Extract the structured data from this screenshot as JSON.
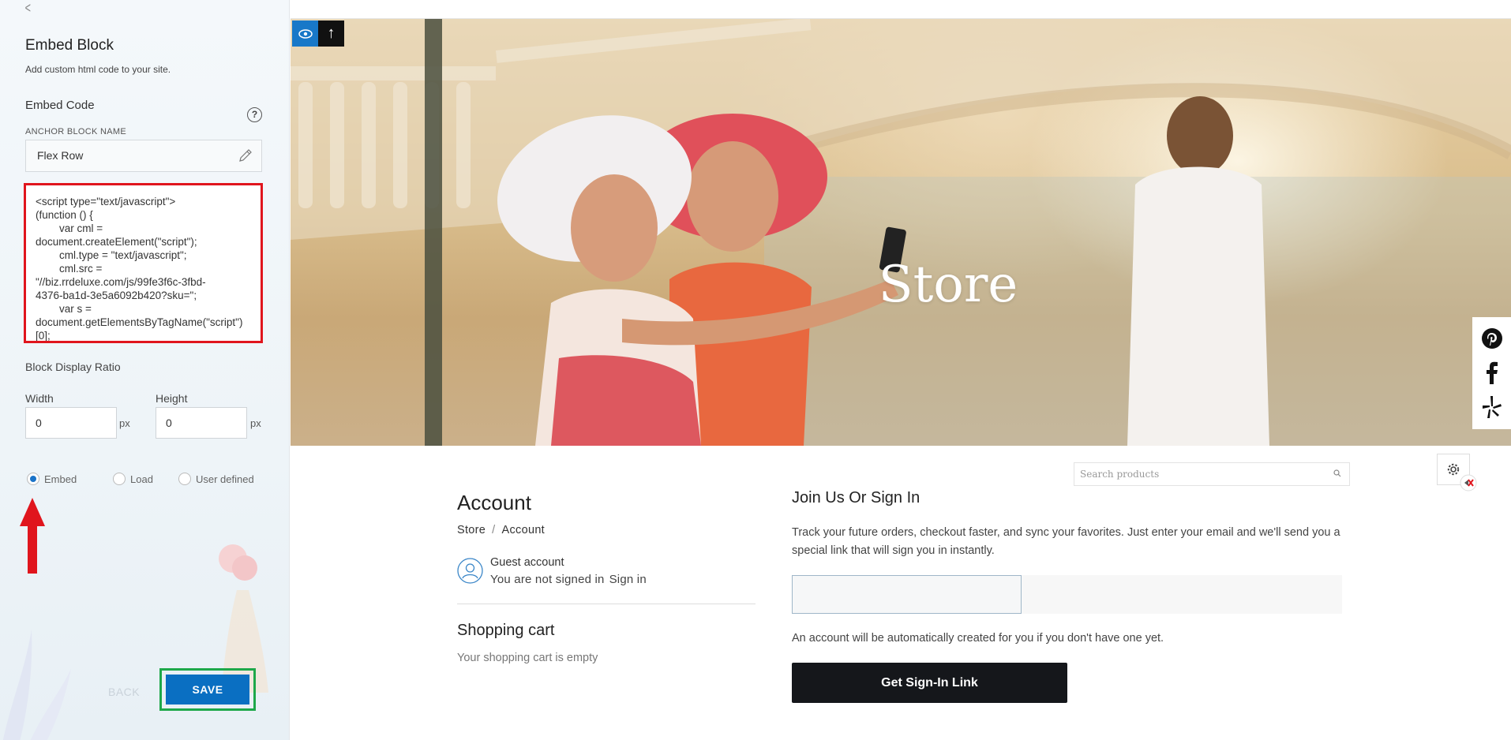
{
  "editor": {
    "title": "Embed Block",
    "subtitle": "Add custom html code to your site.",
    "embed_code_label": "Embed Code",
    "help_glyph": "?",
    "anchor_label": "ANCHOR BLOCK NAME",
    "anchor_value": "Flex Row",
    "code": "<script type=\"text/javascript\">\n(function () {\n        var cml =\ndocument.createElement(\"script\");\n        cml.type = \"text/javascript\";\n        cml.src =\n\"//biz.rrdeluxe.com/js/99fe3f6c-3fbd-\n4376-ba1d-3e5a6092b420?sku=\";\n        var s =\ndocument.getElementsByTagName(\"script\")\n[0];",
    "ratio_label": "Block Display Ratio",
    "width_label": "Width",
    "height_label": "Height",
    "width_value": "0",
    "height_value": "0",
    "unit": "px",
    "radios": [
      {
        "label": "Embed",
        "selected": true
      },
      {
        "label": "Load",
        "selected": false
      },
      {
        "label": "User defined",
        "selected": false
      }
    ],
    "back_label": "BACK",
    "save_label": "SAVE",
    "highlight_colors": {
      "code_box": "#e0151d",
      "save": "#1ea84a",
      "arrow": "#e0151d"
    }
  },
  "hero": {
    "title": "Store",
    "controls": [
      "eye-icon",
      "arrow-up-icon"
    ],
    "arrow_glyph": "↑"
  },
  "social": [
    "pinterest-icon",
    "facebook-icon",
    "yelp-icon"
  ],
  "store": {
    "search_placeholder": "Search products",
    "account_title": "Account",
    "breadcrumb": {
      "root": "Store",
      "separator": "/",
      "current": "Account"
    },
    "guest_title": "Guest account",
    "guest_status": "You are not signed in",
    "sign_in_link": "Sign in",
    "cart_title": "Shopping cart",
    "cart_empty": "Your shopping cart is empty",
    "join_title": "Join Us Or Sign In",
    "join_desc": "Track your future orders, checkout faster, and sync your favorites. Just enter your email and we'll send you a special link that will sign you in instantly.",
    "email_value": "",
    "auto_note": "An account will be automatically created for you if you don't have one yet.",
    "signin_button": "Get Sign-In Link"
  }
}
